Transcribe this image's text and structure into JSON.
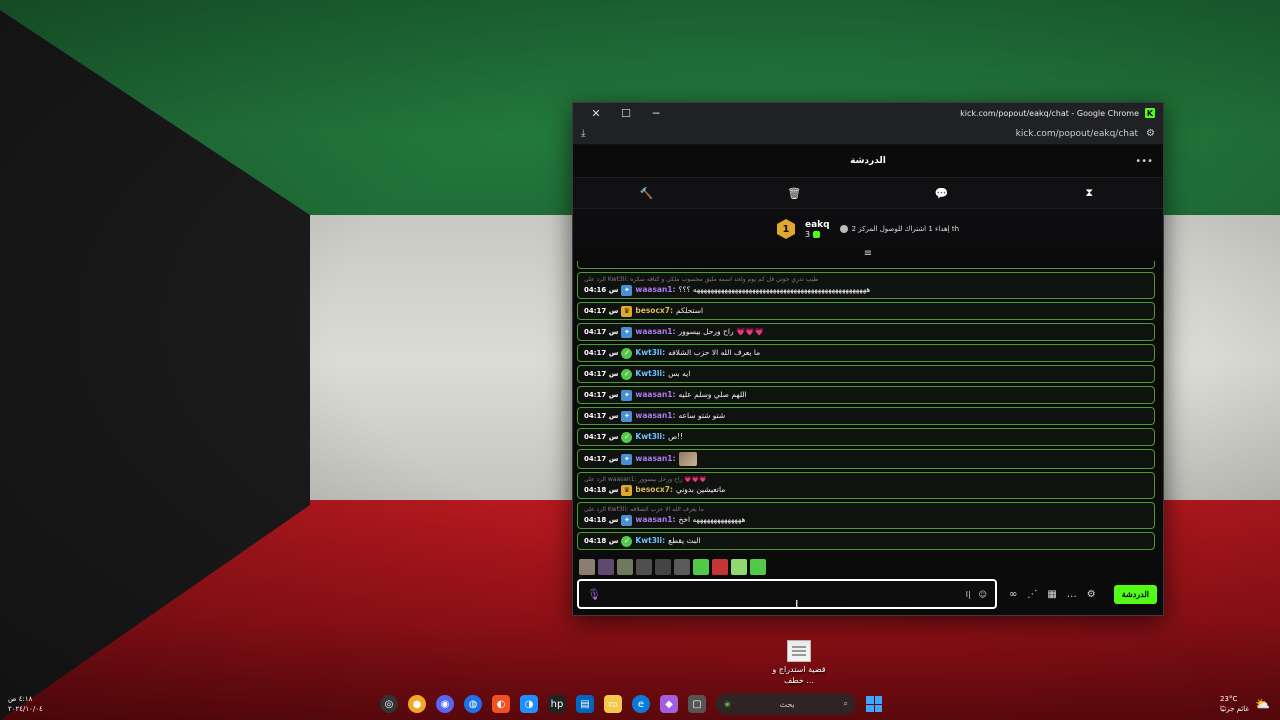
{
  "window": {
    "title": "kick.com/popout/eakq/chat - Google Chrome",
    "url": "kick.com/popout/eakq/chat"
  },
  "chat": {
    "title": "الدردشة",
    "goal": {
      "badge_number": "1",
      "username": "eakq",
      "count": "3",
      "text": "إهداء 1 اشتراك للوصول المركز 2 th"
    },
    "messages": [
      {
        "reply": "الرد على Kwt3li: طيب تدري حوتي فل كم يوم ولحد اسمه مليق محسوب ملكي و كتافه سكره",
        "time": "04:16 س",
        "user": "waasan1:",
        "user_color": "#a97cf0",
        "icon": "sub",
        "text": "ههههههههههههههههههههههههههههههههههههههههههههههههههه ؟؟؟"
      },
      {
        "time": "04:17 س",
        "user": "besocx7:",
        "user_color": "#d9b95b",
        "icon": "crown",
        "text": "استحلكم"
      },
      {
        "time": "04:17 س",
        "user": "waasan1:",
        "user_color": "#a97cf0",
        "icon": "sub",
        "text": "راح ورحل بيسوور 💗💗💗"
      },
      {
        "time": "04:17 س",
        "user": "Kwt3li:",
        "user_color": "#6ec4ff",
        "icon": "verified",
        "text": "ما يعرف الله الا حزب الشلافه"
      },
      {
        "time": "04:17 س",
        "user": "Kwt3li:",
        "user_color": "#6ec4ff",
        "icon": "verified",
        "text": "ايه بس"
      },
      {
        "time": "04:17 س",
        "user": "waasan1:",
        "user_color": "#a97cf0",
        "icon": "sub",
        "text": "اللهم صلي وسلم عليه"
      },
      {
        "time": "04:17 س",
        "user": "waasan1:",
        "user_color": "#a97cf0",
        "icon": "sub",
        "text": "شتو شتو ساعه"
      },
      {
        "time": "04:17 س",
        "user": "Kwt3li:",
        "user_color": "#6ec4ff",
        "icon": "verified",
        "text": "ص!!"
      },
      {
        "time": "04:17 س",
        "user": "waasan1:",
        "user_color": "#a97cf0",
        "icon": "sub",
        "text": ""
      },
      {
        "reply": "الرد على waasan1: راح ورحل بيسوور 💗💗💗",
        "time": "04:18 س",
        "user": "besocx7:",
        "user_color": "#d9b95b",
        "icon": "crown",
        "text": "ماتعيشين بدوني"
      },
      {
        "reply": "الرد على Kwt3li: ما يعرف الله الا حزب الشلافه",
        "time": "04:18 س",
        "user": "waasan1:",
        "user_color": "#a97cf0",
        "icon": "sub",
        "text": "ههههههههههههههه اخخ"
      },
      {
        "time": "04:18 س",
        "user": "Kwt3li:",
        "user_color": "#6ec4ff",
        "icon": "verified",
        "text": "البث يقطع"
      }
    ],
    "send_label": "الدردشة",
    "input_placeholder": "ا|"
  },
  "desktop_icon": {
    "label": "قضية استدراج و خطف ..."
  },
  "taskbar": {
    "time": "٤:١٨ ص",
    "date": "٢٠٢٤/١٠/٠٤",
    "search_placeholder": "بحث",
    "weather_temp": "23°C",
    "weather_desc": "غائم جزئيًا"
  },
  "colors": {
    "accent": "#53fc18",
    "message_border": "#4b9a33"
  }
}
